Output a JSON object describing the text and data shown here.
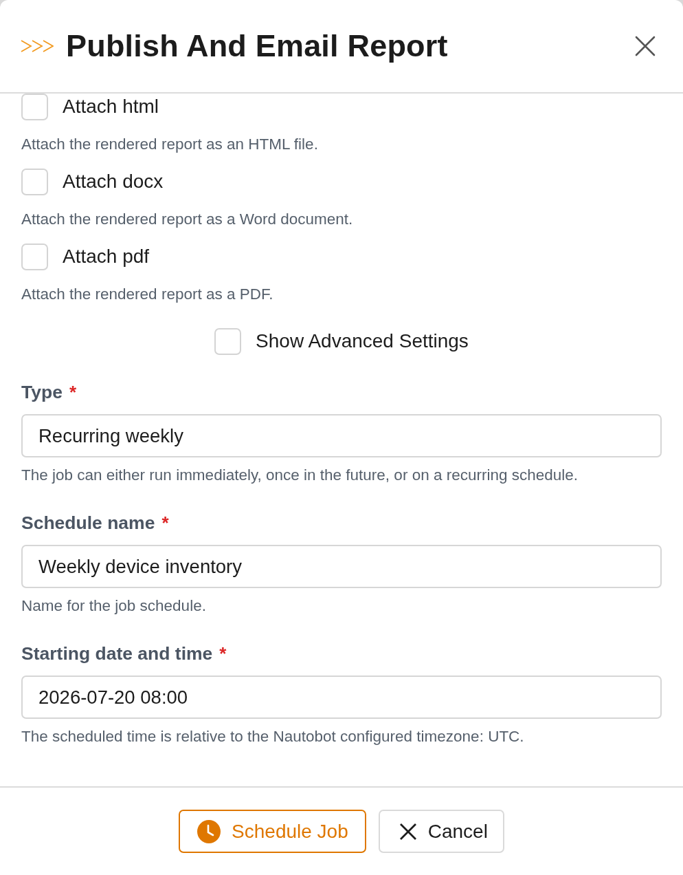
{
  "dialog": {
    "title": "Publish And Email Report"
  },
  "options": [
    {
      "label": "Attach html",
      "help": "Attach the rendered report as an HTML file.",
      "checked": false
    },
    {
      "label": "Attach docx",
      "help": "Attach the rendered report as a Word document.",
      "checked": false
    },
    {
      "label": "Attach pdf",
      "help": "Attach the rendered report as a PDF.",
      "checked": false
    }
  ],
  "advanced_toggle": {
    "label": "Show Advanced Settings",
    "checked": false
  },
  "fields": [
    {
      "label": "Type",
      "required_mark": "*",
      "value": "Recurring weekly",
      "help": "The job can either run immediately, once in the future, or on a recurring schedule."
    },
    {
      "label": "Schedule name",
      "required_mark": "*",
      "value": "Weekly device inventory",
      "help": "Name for the job schedule."
    },
    {
      "label": "Starting date and time",
      "required_mark": "*",
      "value": "2026-07-20 08:00",
      "help": "The scheduled time is relative to the Nautobot configured timezone: UTC."
    }
  ],
  "buttons": [
    {
      "kind": "schedule",
      "label": "Schedule Job"
    },
    {
      "kind": "cancel",
      "label": "Cancel"
    }
  ]
}
